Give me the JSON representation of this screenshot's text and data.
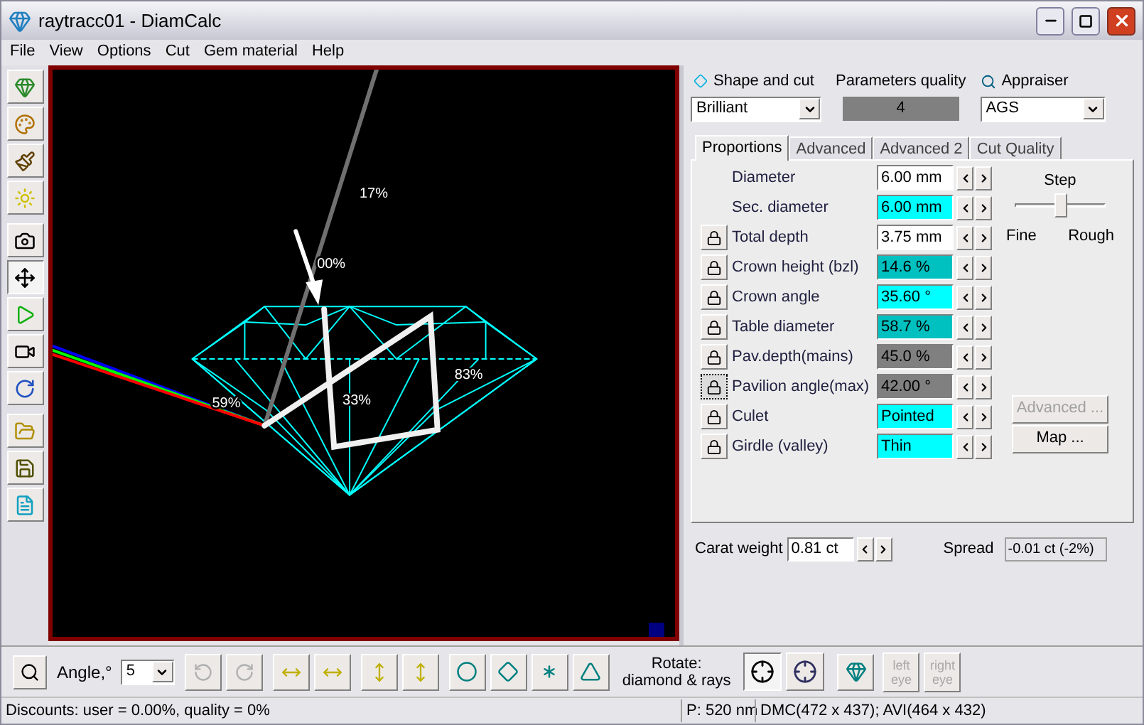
{
  "window": {
    "title": "raytracc01 - DiamCalc"
  },
  "menu": [
    "File",
    "View",
    "Options",
    "Cut",
    "Gem material",
    "Help"
  ],
  "left_toolbar": [
    {
      "selected": false
    },
    {
      "selected": false
    },
    {
      "selected": false
    },
    {
      "selected": false
    },
    {
      "selected": false
    },
    {
      "selected": true
    },
    {
      "selected": false
    },
    {
      "selected": false
    },
    {
      "selected": false
    },
    {
      "selected": false
    },
    {
      "selected": false
    },
    {
      "selected": false
    }
  ],
  "viewport": {
    "labels": [
      {
        "text": "17%"
      },
      {
        "text": "00%"
      },
      {
        "text": "59%"
      },
      {
        "text": "33%"
      },
      {
        "text": "83%"
      }
    ]
  },
  "shape_and_cut": {
    "label": "Shape and cut",
    "value": "Brilliant"
  },
  "parameters_quality": {
    "label": "Parameters quality",
    "value": "4"
  },
  "appraiser": {
    "label": "Appraiser",
    "value": "AGS"
  },
  "tabs": [
    {
      "label": "Proportions",
      "selected": true
    },
    {
      "label": "Advanced",
      "selected": false
    },
    {
      "label": "Advanced 2",
      "selected": false
    },
    {
      "label": "Cut Quality",
      "selected": false
    }
  ],
  "parameters": [
    {
      "label": "Diameter",
      "value": "6.00 mm",
      "color": "#ffffff",
      "lock": false
    },
    {
      "label": "Sec. diameter",
      "value": "6.00 mm",
      "color": "#00ffff",
      "lock": false
    },
    {
      "label": "Total depth",
      "value": "3.75 mm",
      "color": "#ffffff",
      "lock": true,
      "focused": false
    },
    {
      "label": "Crown height (bzl)",
      "value": "14.6 %",
      "color": "#00c0c0",
      "lock": true,
      "focused": false
    },
    {
      "label": "Crown angle",
      "value": "35.60 °",
      "color": "#00ffff",
      "lock": true,
      "focused": false
    },
    {
      "label": "Table diameter",
      "value": "58.7 %",
      "color": "#00c0c0",
      "lock": true,
      "focused": false
    },
    {
      "label": "Pav.depth(mains)",
      "value": "45.0 %",
      "color": "#808080",
      "lock": true,
      "focused": false
    },
    {
      "label": "Pavilion angle(max)",
      "value": "42.00 °",
      "color": "#808080",
      "lock": true,
      "focused": true
    },
    {
      "label": "Culet",
      "value": "Pointed",
      "color": "#00ffff",
      "lock": true,
      "focused": false
    },
    {
      "label": "Girdle (valley)",
      "value": "Thin",
      "color": "#00ffff",
      "lock": true,
      "focused": false
    }
  ],
  "step": {
    "label": "Step",
    "level": 0.5,
    "min_label": "Fine",
    "max_label": "Rough"
  },
  "side_buttons": [
    {
      "label": "Advanced ...",
      "disabled": true
    },
    {
      "label": "Map ...",
      "disabled": false
    }
  ],
  "carat_weight": {
    "label": "Carat weight",
    "value": "0.81 ct"
  },
  "spread": {
    "label": "Spread",
    "value": "-0.01 ct (-2%)"
  },
  "bottom_toolbar": {
    "angle_label": "Angle,°",
    "angle_value": "5",
    "rotate_buttons": [
      {
        "disabled": true
      },
      {
        "disabled": true
      },
      {
        "disabled": false
      },
      {
        "disabled": false
      },
      {
        "disabled": false
      },
      {
        "disabled": false
      }
    ],
    "rotate_label": "Rotate:",
    "rotate_target": "diamond & rays",
    "ray_toggles": [
      {
        "selected": true
      },
      {
        "selected": false
      }
    ],
    "eye_buttons": [
      {
        "label": "left eye",
        "disabled": true
      },
      {
        "label": "right eye",
        "disabled": true
      }
    ]
  },
  "status_bar": {
    "discounts": "Discounts: user = 0.00%, quality = 0%",
    "wavelength": "P: 520 nm",
    "sizes": "DMC(472 x 437); AVI(464 x 432)"
  }
}
